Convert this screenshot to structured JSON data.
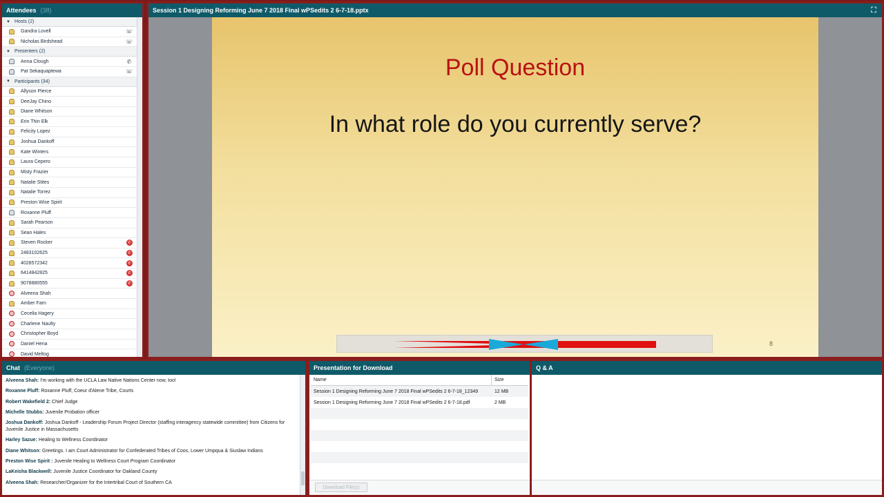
{
  "attendees": {
    "title": "Attendees",
    "count": "(38)",
    "groups": {
      "hosts": {
        "label": "Hosts (2)",
        "members": [
          "Gandra Lovell",
          "Nicholas Birdshead"
        ]
      },
      "presenters": {
        "label": "Presenters (2)",
        "members": [
          "Anna Clough",
          "Pat Sekaquaptewa"
        ]
      },
      "participants": {
        "label": "Participants (34)",
        "members": [
          "Allyson Pierce",
          "DeeJay Chino",
          "Diane Whitson",
          "Erin Thin Elk",
          "Felicity Lopez",
          "Joshua Dankoff",
          "Kate Winters",
          "Laura Cepero",
          "Misty Frazier",
          "Natalie Stites",
          "Natalie Torrez",
          "Preston Wise Spirit",
          "Roxanne Pluff",
          "Sarah Pearson",
          "Sean Hales",
          "Steven Rocker",
          "2483102625",
          "4028572342",
          "6414842825",
          "9078880555",
          "Alveena Shah",
          "Amber Farn",
          "Cecelia Hagery",
          "Charlene Naulty",
          "Christopher Boyd",
          "Daniel Hena",
          "David Meltog"
        ]
      }
    }
  },
  "presentation": {
    "title": "Session 1 Designing Reforming June 7 2018 Final wPSedits 2 6-7-18.pptx",
    "slide": {
      "title": "Poll Question",
      "question": "In what role do you currently serve?",
      "number": "8"
    },
    "title_color": "#b81212"
  },
  "chat": {
    "title": "Chat",
    "scope": "(Everyone)",
    "messages": [
      {
        "sender": "Alveena Shah:",
        "text": " I'm working with the UCLA Law Native Nations Center now, too!"
      },
      {
        "sender": "Roxanne Pluff:",
        "text": " Roxanne Pluff, Coeur d'Alene Tribe, Courts"
      },
      {
        "sender": "Robert Wakefield 2:",
        "text": " Chief Judge"
      },
      {
        "sender": "Michelle Stubbs:",
        "text": " Juvenile Probation officer"
      },
      {
        "sender": "Joshua Dankoff:",
        "text": " Joshua Dankoff - Leadership Forum Project Director (staffing interagency statewide committee) from Citizens for Juvenile Justice in Massachusetts"
      },
      {
        "sender": "Harley Sazue:",
        "text": " Healing to Wellness Coordinator"
      },
      {
        "sender": "Diane Whitson:",
        "text": " Greetings.  I am Court Administrator for Confederated Tribes  of Coos, Lower Umpqua & Siuslaw Indians"
      },
      {
        "sender": "Preston Wise Spirit :",
        "text": " Juvenile Healing to Wellness Court Program Coordinator"
      },
      {
        "sender": "LaKeisha Blackwell:",
        "text": " Juvenile Justice Coordinator for Oakland County"
      },
      {
        "sender": "Alveena Shah:",
        "text": " Researcher/Organizer for the Intertribal Court of Southern CA"
      }
    ]
  },
  "files": {
    "title": "Presentation for Download",
    "columns": {
      "name": "Name",
      "size": "Size"
    },
    "rows": [
      {
        "name": "Session 1 Designing Reforming June 7 2018 Final wPSedits 2 6-7-18_12349",
        "size": "12 MB"
      },
      {
        "name": "Session 1 Designing Reforming June 7 2018 Final wPSedits 2 6-7-18.pdf",
        "size": "2 MB"
      }
    ],
    "download_label": "Download File(s)"
  },
  "qa": {
    "title": "Q & A"
  },
  "colors": {
    "pod_header": "#0f5a68",
    "frame": "#8a1d1d"
  }
}
